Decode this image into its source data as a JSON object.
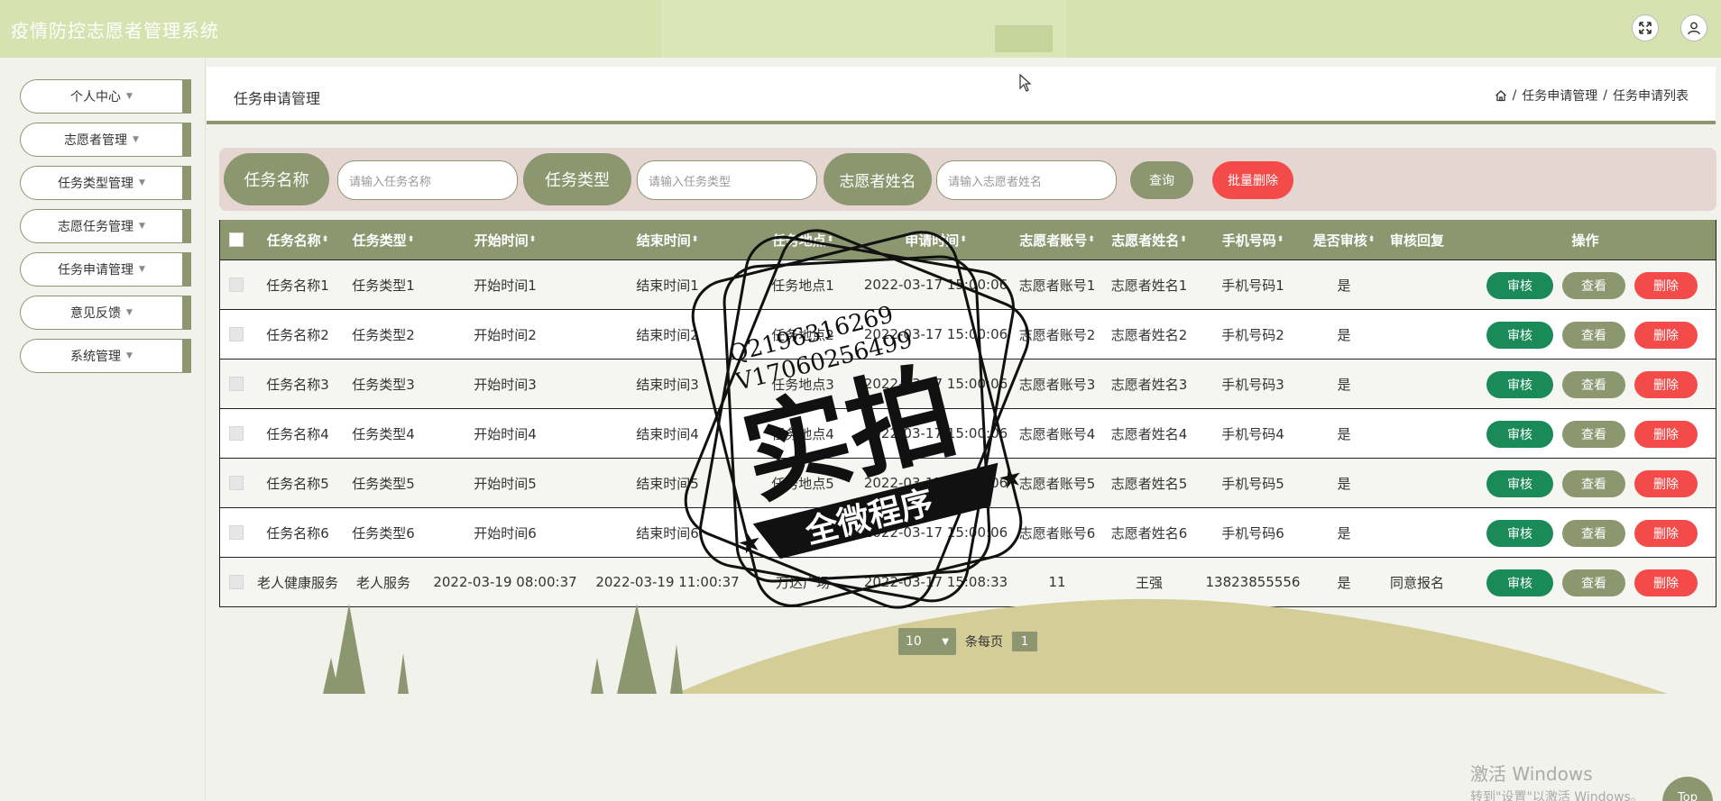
{
  "header": {
    "app_title": "疫情防控志愿者管理系统",
    "expand_icon": "expand-icon",
    "user_icon": "user-icon"
  },
  "sidebar": {
    "items": [
      {
        "label": "个人中心"
      },
      {
        "label": "志愿者管理"
      },
      {
        "label": "任务类型管理"
      },
      {
        "label": "志愿任务管理"
      },
      {
        "label": "任务申请管理"
      },
      {
        "label": "意见反馈"
      },
      {
        "label": "系统管理"
      }
    ]
  },
  "breadcrumb": {
    "page_title": "任务申请管理",
    "home_icon": "home-icon",
    "sep": "/",
    "level1": "任务申请管理",
    "level2": "任务申请列表"
  },
  "search": {
    "task_name_label": "任务名称",
    "task_name_placeholder": "请输入任务名称",
    "task_type_label": "任务类型",
    "task_type_placeholder": "请输入任务类型",
    "volunteer_name_label": "志愿者姓名",
    "volunteer_name_placeholder": "请输入志愿者姓名",
    "query_label": "查询",
    "batch_delete_label": "批量删除"
  },
  "table": {
    "sort_glyph": "⬍",
    "columns": [
      "任务名称",
      "任务类型",
      "开始时间",
      "结束时间",
      "任务地点",
      "申请时间",
      "志愿者账号",
      "志愿者姓名",
      "手机号码",
      "是否审核",
      "审核回复",
      "操作"
    ],
    "rows": [
      {
        "task_name": "任务名称1",
        "task_type": "任务类型1",
        "start": "开始时间1",
        "end": "结束时间1",
        "location": "任务地点1",
        "apply_time": "2022-03-17 15:00:06",
        "account": "志愿者账号1",
        "vname": "志愿者姓名1",
        "phone": "手机号码1",
        "reviewed": "是",
        "reply": ""
      },
      {
        "task_name": "任务名称2",
        "task_type": "任务类型2",
        "start": "开始时间2",
        "end": "结束时间2",
        "location": "任务地点2",
        "apply_time": "2022-03-17 15:00:06",
        "account": "志愿者账号2",
        "vname": "志愿者姓名2",
        "phone": "手机号码2",
        "reviewed": "是",
        "reply": ""
      },
      {
        "task_name": "任务名称3",
        "task_type": "任务类型3",
        "start": "开始时间3",
        "end": "结束时间3",
        "location": "任务地点3",
        "apply_time": "2022-03-17 15:00:06",
        "account": "志愿者账号3",
        "vname": "志愿者姓名3",
        "phone": "手机号码3",
        "reviewed": "是",
        "reply": ""
      },
      {
        "task_name": "任务名称4",
        "task_type": "任务类型4",
        "start": "开始时间4",
        "end": "结束时间4",
        "location": "任务地点4",
        "apply_time": "2022-03-17 15:00:06",
        "account": "志愿者账号4",
        "vname": "志愿者姓名4",
        "phone": "手机号码4",
        "reviewed": "是",
        "reply": ""
      },
      {
        "task_name": "任务名称5",
        "task_type": "任务类型5",
        "start": "开始时间5",
        "end": "结束时间5",
        "location": "任务地点5",
        "apply_time": "2022-03-17 15:00:06",
        "account": "志愿者账号5",
        "vname": "志愿者姓名5",
        "phone": "手机号码5",
        "reviewed": "是",
        "reply": ""
      },
      {
        "task_name": "任务名称6",
        "task_type": "任务类型6",
        "start": "开始时间6",
        "end": "结束时间6",
        "location": "任务地点6",
        "apply_time": "2022-03-17 15:00:06",
        "account": "志愿者账号6",
        "vname": "志愿者姓名6",
        "phone": "手机号码6",
        "reviewed": "是",
        "reply": ""
      },
      {
        "task_name": "老人健康服务",
        "task_type": "老人服务",
        "start": "2022-03-19 08:00:37",
        "end": "2022-03-19 11:00:37",
        "location": "万达广场",
        "apply_time": "2022-03-17 15:08:33",
        "account": "11",
        "vname": "王强",
        "phone": "13823855556",
        "reviewed": "是",
        "reply": "同意报名"
      }
    ],
    "actions": {
      "audit": "审核",
      "view": "查看",
      "delete": "删除"
    }
  },
  "pagination": {
    "page_size": "10",
    "per_page_label": "条每页",
    "current_page": "1"
  },
  "watermark": {
    "contact_q": "Q2196316269",
    "contact_v": "V17060256499",
    "stamp_main": "实拍",
    "stamp_sub": "全微程序"
  },
  "windows_activation": {
    "line1": "激活 Windows",
    "line2": "转到\"设置\"以激活 Windows。"
  },
  "top_button": "Top",
  "colors": {
    "accent": "#8c9770",
    "header": "#d6e2b0",
    "danger": "#f34a4a",
    "audit": "#1a8a58"
  }
}
